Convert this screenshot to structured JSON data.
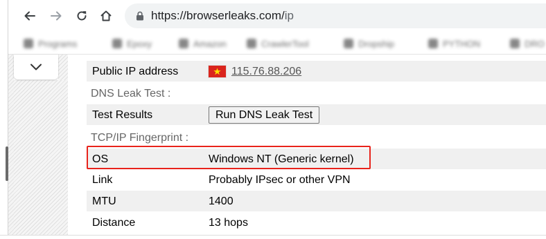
{
  "browser": {
    "url_host": "https://browserleaks.com/",
    "url_path": "ip",
    "icons": [
      "back-arrow-icon",
      "forward-arrow-icon",
      "reload-icon",
      "home-icon",
      "lock-icon"
    ]
  },
  "bookmarks": [
    {
      "label": "Programs"
    },
    {
      "label": "Epoxy"
    },
    {
      "label": "Amazon"
    },
    {
      "label": "CrawlerTool"
    },
    {
      "label": "Dropship"
    },
    {
      "label": "PYTHON"
    },
    {
      "label": "DRO"
    }
  ],
  "page": {
    "public_ip": {
      "label": "Public IP address",
      "value": "115.76.88.206",
      "flag": "vietnam-flag-icon"
    },
    "dns_section": "DNS Leak Test :",
    "test_results": {
      "label": "Test Results",
      "button_label": "Run DNS Leak Test"
    },
    "tcp_section": "TCP/IP Fingerprint :",
    "fingerprint": [
      {
        "label": "OS",
        "value": "Windows NT (Generic kernel)",
        "highlighted": true
      },
      {
        "label": "Link",
        "value": "Probably IPsec or other VPN"
      },
      {
        "label": "MTU",
        "value": "1400"
      },
      {
        "label": "Distance",
        "value": "13 hops"
      }
    ]
  },
  "colors": {
    "highlight_border": "#e8231b",
    "row_shade": "#f0f0f0",
    "section_text": "#666666",
    "flag_red": "#da251d",
    "flag_star": "#ffde00"
  }
}
